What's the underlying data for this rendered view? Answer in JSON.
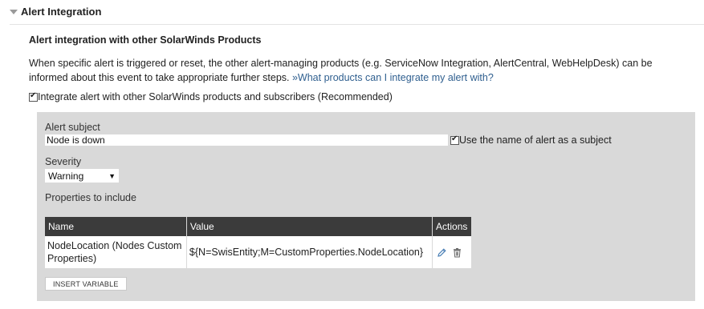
{
  "section": {
    "title": "Alert Integration"
  },
  "subheading": "Alert integration with other SolarWinds Products",
  "description": {
    "text": "When specific alert is triggered or reset, the other alert-managing products (e.g. ServiceNow Integration, AlertCentral, WebHelpDesk) can be informed about this event to take appropriate further steps.",
    "link": "»What products can I integrate my alert with?"
  },
  "integrate": {
    "checked": true,
    "label": "Integrate alert with other SolarWinds products and subscribers (Recommended)"
  },
  "form": {
    "subject_label": "Alert subject",
    "subject_value": "Node is down",
    "use_name_checked": true,
    "use_name_label": "Use the name of alert as a subject",
    "severity_label": "Severity",
    "severity_value": "Warning",
    "properties_label": "Properties to include"
  },
  "table": {
    "headers": [
      "Name",
      "Value",
      "Actions"
    ],
    "rows": [
      {
        "name": "NodeLocation (Nodes Custom Properties)",
        "value": "${N=SwisEntity;M=CustomProperties.NodeLocation}"
      }
    ]
  },
  "insert_button_label": "INSERT VARIABLE",
  "icons": {
    "expand": "triangle-down-icon",
    "edit": "pencil-icon",
    "delete": "trash-icon"
  },
  "colors": {
    "table_header": "#3b3b3b",
    "panel_bg": "#d9d9d9",
    "link": "#2f5f8f",
    "edit_icon": "#4a7fb5"
  }
}
